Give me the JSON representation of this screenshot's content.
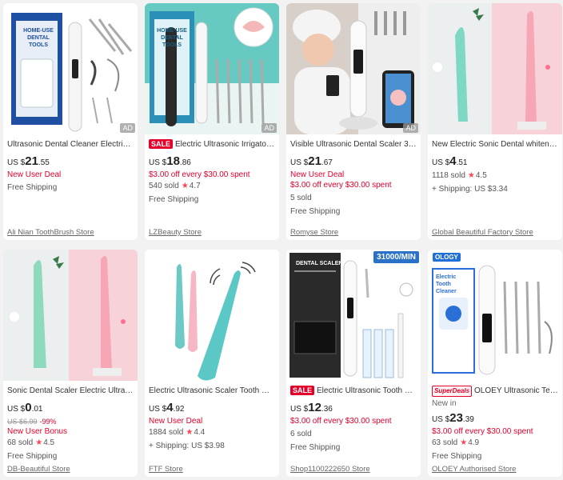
{
  "products": [
    {
      "title": "Ultrasonic Dental Cleaner Electric ...",
      "tag": "",
      "price": {
        "currency": "US $",
        "whole": "21",
        "decimal": ".55"
      },
      "old_price": "",
      "discount": "",
      "promo1": "New User Deal",
      "promo2": "",
      "sold": "",
      "rating": "",
      "shipping": "Free Shipping",
      "store": "Ali Nian ToothBrush Store",
      "ad_badge": "AD",
      "overlay_text": "HOME-USE DENTAL TOOLS"
    },
    {
      "title": "Electric Ultrasonic Irrigator ...",
      "tag": "SALE",
      "price": {
        "currency": "US $",
        "whole": "18",
        "decimal": ".86"
      },
      "old_price": "",
      "discount": "",
      "promo1": "$3.00 off every $30.00 spent",
      "promo2": "",
      "sold": "540 sold",
      "rating": "4.7",
      "shipping": "Free Shipping",
      "store": "LZBeauty Store",
      "ad_badge": "AD",
      "overlay_text": "HOME-USE DENTAL TOOLS"
    },
    {
      "title": "Visible Ultrasonic Dental Scaler 30...",
      "tag": "",
      "price": {
        "currency": "US $",
        "whole": "21",
        "decimal": ".67"
      },
      "old_price": "",
      "discount": "",
      "promo1": "New User Deal",
      "promo2": "$3.00 off every $30.00 spent",
      "sold": "5 sold",
      "rating": "",
      "shipping": "Free Shipping",
      "store": "Romyse Store",
      "ad_badge": "AD",
      "overlay_text": ""
    },
    {
      "title": "New Electric Sonic Dental whitener...",
      "tag": "",
      "price": {
        "currency": "US $",
        "whole": "4",
        "decimal": ".51"
      },
      "old_price": "",
      "discount": "",
      "promo1": "",
      "promo2": "",
      "sold": "1118 sold",
      "rating": "4.5",
      "shipping": "+ Shipping: US $3.34",
      "store": "Global Beautiful Factory Store",
      "ad_badge": "",
      "overlay_text": ""
    },
    {
      "title": "Sonic Dental Scaler Electric Ultraso...",
      "tag": "",
      "price": {
        "currency": "US $",
        "whole": "0",
        "decimal": ".01"
      },
      "old_price": "US $6.99",
      "discount": "-99%",
      "promo1": "New User Bonus",
      "promo2": "",
      "sold": "68 sold",
      "rating": "4.5",
      "shipping": "Free Shipping",
      "store": "DB-Beautiful Store",
      "ad_badge": "",
      "overlay_text": ""
    },
    {
      "title": "Electric Ultrasonic Scaler Tooth Cal...",
      "tag": "",
      "price": {
        "currency": "US $",
        "whole": "4",
        "decimal": ".92"
      },
      "old_price": "",
      "discount": "",
      "promo1": "New User Deal",
      "promo2": "",
      "sold": "1884 sold",
      "rating": "4.4",
      "shipping": "+ Shipping: US $3.98",
      "store": "FTF Store",
      "ad_badge": "",
      "overlay_text": ""
    },
    {
      "title": "Electric Ultrasonic Tooth Cl...",
      "tag": "SALE",
      "price": {
        "currency": "US $",
        "whole": "12",
        "decimal": ".36"
      },
      "old_price": "",
      "discount": "",
      "promo1": "$3.00 off every $30.00 spent",
      "promo2": "",
      "sold": "6 sold",
      "rating": "",
      "shipping": "Free Shipping",
      "store": "Shop1100222650 Store",
      "ad_badge": "",
      "overlay_text": "DENTAL SCALER",
      "watermark": "31000/MIN"
    },
    {
      "title": "OLOEY Ultrasonic Teeth ...",
      "tag": "SuperDeals",
      "new_in": "New in",
      "price": {
        "currency": "US $",
        "whole": "23",
        "decimal": ".39"
      },
      "old_price": "",
      "discount": "",
      "promo1": "$3.00 off every $30.00 spent",
      "promo2": "",
      "sold": "63 sold",
      "rating": "4.9",
      "shipping": "Free Shipping",
      "store": "OLOEY Authorised Store",
      "ad_badge": "",
      "overlay_text": "Electric Tooth Cleaner",
      "logo": "OLOGY"
    }
  ],
  "colors": {
    "accent_red": "#e4002b",
    "star": "#ff4455",
    "link_gray": "#666666"
  },
  "icons": {
    "rating": "star-icon"
  }
}
